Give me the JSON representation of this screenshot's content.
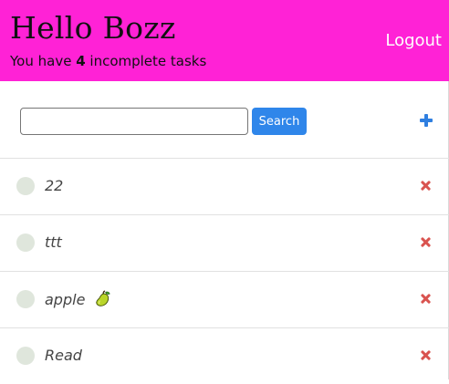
{
  "header": {
    "greeting": "Hello Bozz",
    "subtitle_prefix": "You have ",
    "incomplete_count": "4",
    "subtitle_suffix": " incomplete tasks",
    "logout_label": "Logout",
    "background_color": "#ff22d6"
  },
  "toolbar": {
    "search_value": "",
    "search_placeholder": "",
    "search_button_label": "Search",
    "add_icon": "plus-icon"
  },
  "tasks": [
    {
      "text": "22",
      "completed": false,
      "emoji": ""
    },
    {
      "text": "ttt",
      "completed": false,
      "emoji": ""
    },
    {
      "text": "apple ",
      "completed": false,
      "emoji": "pear-icon"
    },
    {
      "text": "Read",
      "completed": false,
      "emoji": ""
    }
  ],
  "colors": {
    "accent": "#2f86ea",
    "delete": "#d9534f",
    "checkbox": "#dfe6dc"
  }
}
